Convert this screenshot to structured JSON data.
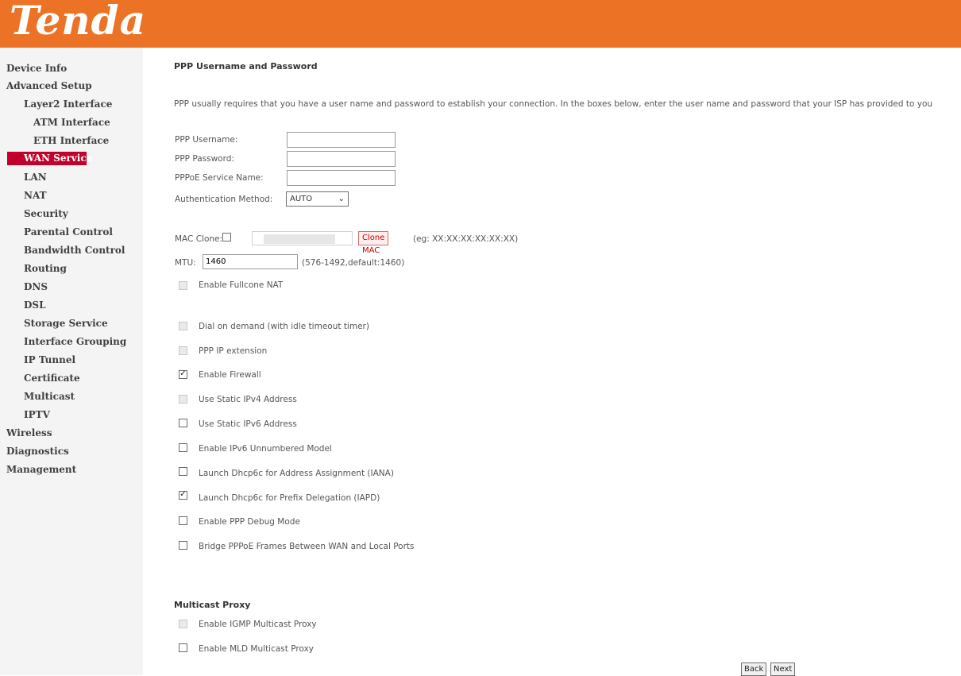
{
  "brand": {
    "logo_text": "Tenda",
    "header_color": "#ec7325",
    "active_color": "#c1002b"
  },
  "sidebar": {
    "items": [
      {
        "label": "Device Info"
      },
      {
        "label": "Advanced Setup"
      },
      {
        "label": "Layer2 Interface"
      },
      {
        "label": "ATM Interface"
      },
      {
        "label": "ETH Interface"
      },
      {
        "label": "WAN Service",
        "active": true
      },
      {
        "label": "LAN"
      },
      {
        "label": "NAT"
      },
      {
        "label": "Security"
      },
      {
        "label": "Parental Control"
      },
      {
        "label": "Bandwidth Control"
      },
      {
        "label": "Routing"
      },
      {
        "label": "DNS"
      },
      {
        "label": "DSL"
      },
      {
        "label": "Storage Service"
      },
      {
        "label": "Interface Grouping"
      },
      {
        "label": "IP Tunnel"
      },
      {
        "label": "Certificate"
      },
      {
        "label": "Multicast"
      },
      {
        "label": "IPTV"
      },
      {
        "label": "Wireless"
      },
      {
        "label": "Diagnostics"
      },
      {
        "label": "Management"
      }
    ]
  },
  "main": {
    "title": "PPP Username and Password",
    "description": "PPP usually requires that you have a user name and password to establish your connection. In the boxes below, enter the user name and password that your ISP has provided to you",
    "fields": {
      "username_label": "PPP Username:",
      "username_value": "",
      "password_label": "PPP Password:",
      "password_value": "",
      "service_name_label": "PPPoE Service Name:",
      "service_name_value": "",
      "auth_label": "Authentication Method:",
      "auth_value": "AUTO"
    },
    "mac_clone": {
      "label": "MAC Clone:",
      "checked": false,
      "button_label": "Clone MAC",
      "hint": "(eg: XX:XX:XX:XX:XX:XX)"
    },
    "mtu": {
      "label": "MTU:",
      "value": "1460",
      "hint": "(576-1492,default:1460)"
    },
    "options": [
      {
        "label": "Enable Fullcone NAT",
        "checked": false,
        "disabled": true
      },
      {
        "label": "Dial on demand (with idle timeout timer)",
        "checked": false,
        "disabled": true
      },
      {
        "label": "PPP IP extension",
        "checked": false,
        "disabled": true
      },
      {
        "label": "Enable Firewall",
        "checked": true,
        "disabled": false
      },
      {
        "label": "Use Static IPv4 Address",
        "checked": false,
        "disabled": true
      },
      {
        "label": "Use Static IPv6 Address",
        "checked": false,
        "disabled": false
      },
      {
        "label": "Enable IPv6 Unnumbered Model",
        "checked": false,
        "disabled": false
      },
      {
        "label": "Launch Dhcp6c for Address Assignment (IANA)",
        "checked": false,
        "disabled": false
      },
      {
        "label": "Launch Dhcp6c for Prefix Delegation (IAPD)",
        "checked": true,
        "disabled": false
      },
      {
        "label": "Enable PPP Debug Mode",
        "checked": false,
        "disabled": false
      },
      {
        "label": "Bridge PPPoE Frames Between WAN and Local Ports",
        "checked": false,
        "disabled": false
      }
    ],
    "multicast": {
      "title": "Multicast Proxy",
      "options": [
        {
          "label": "Enable IGMP Multicast Proxy",
          "checked": false,
          "disabled": true
        },
        {
          "label": "Enable MLD Multicast Proxy",
          "checked": false,
          "disabled": false
        }
      ]
    },
    "buttons": {
      "back": "Back",
      "next": "Next"
    }
  }
}
